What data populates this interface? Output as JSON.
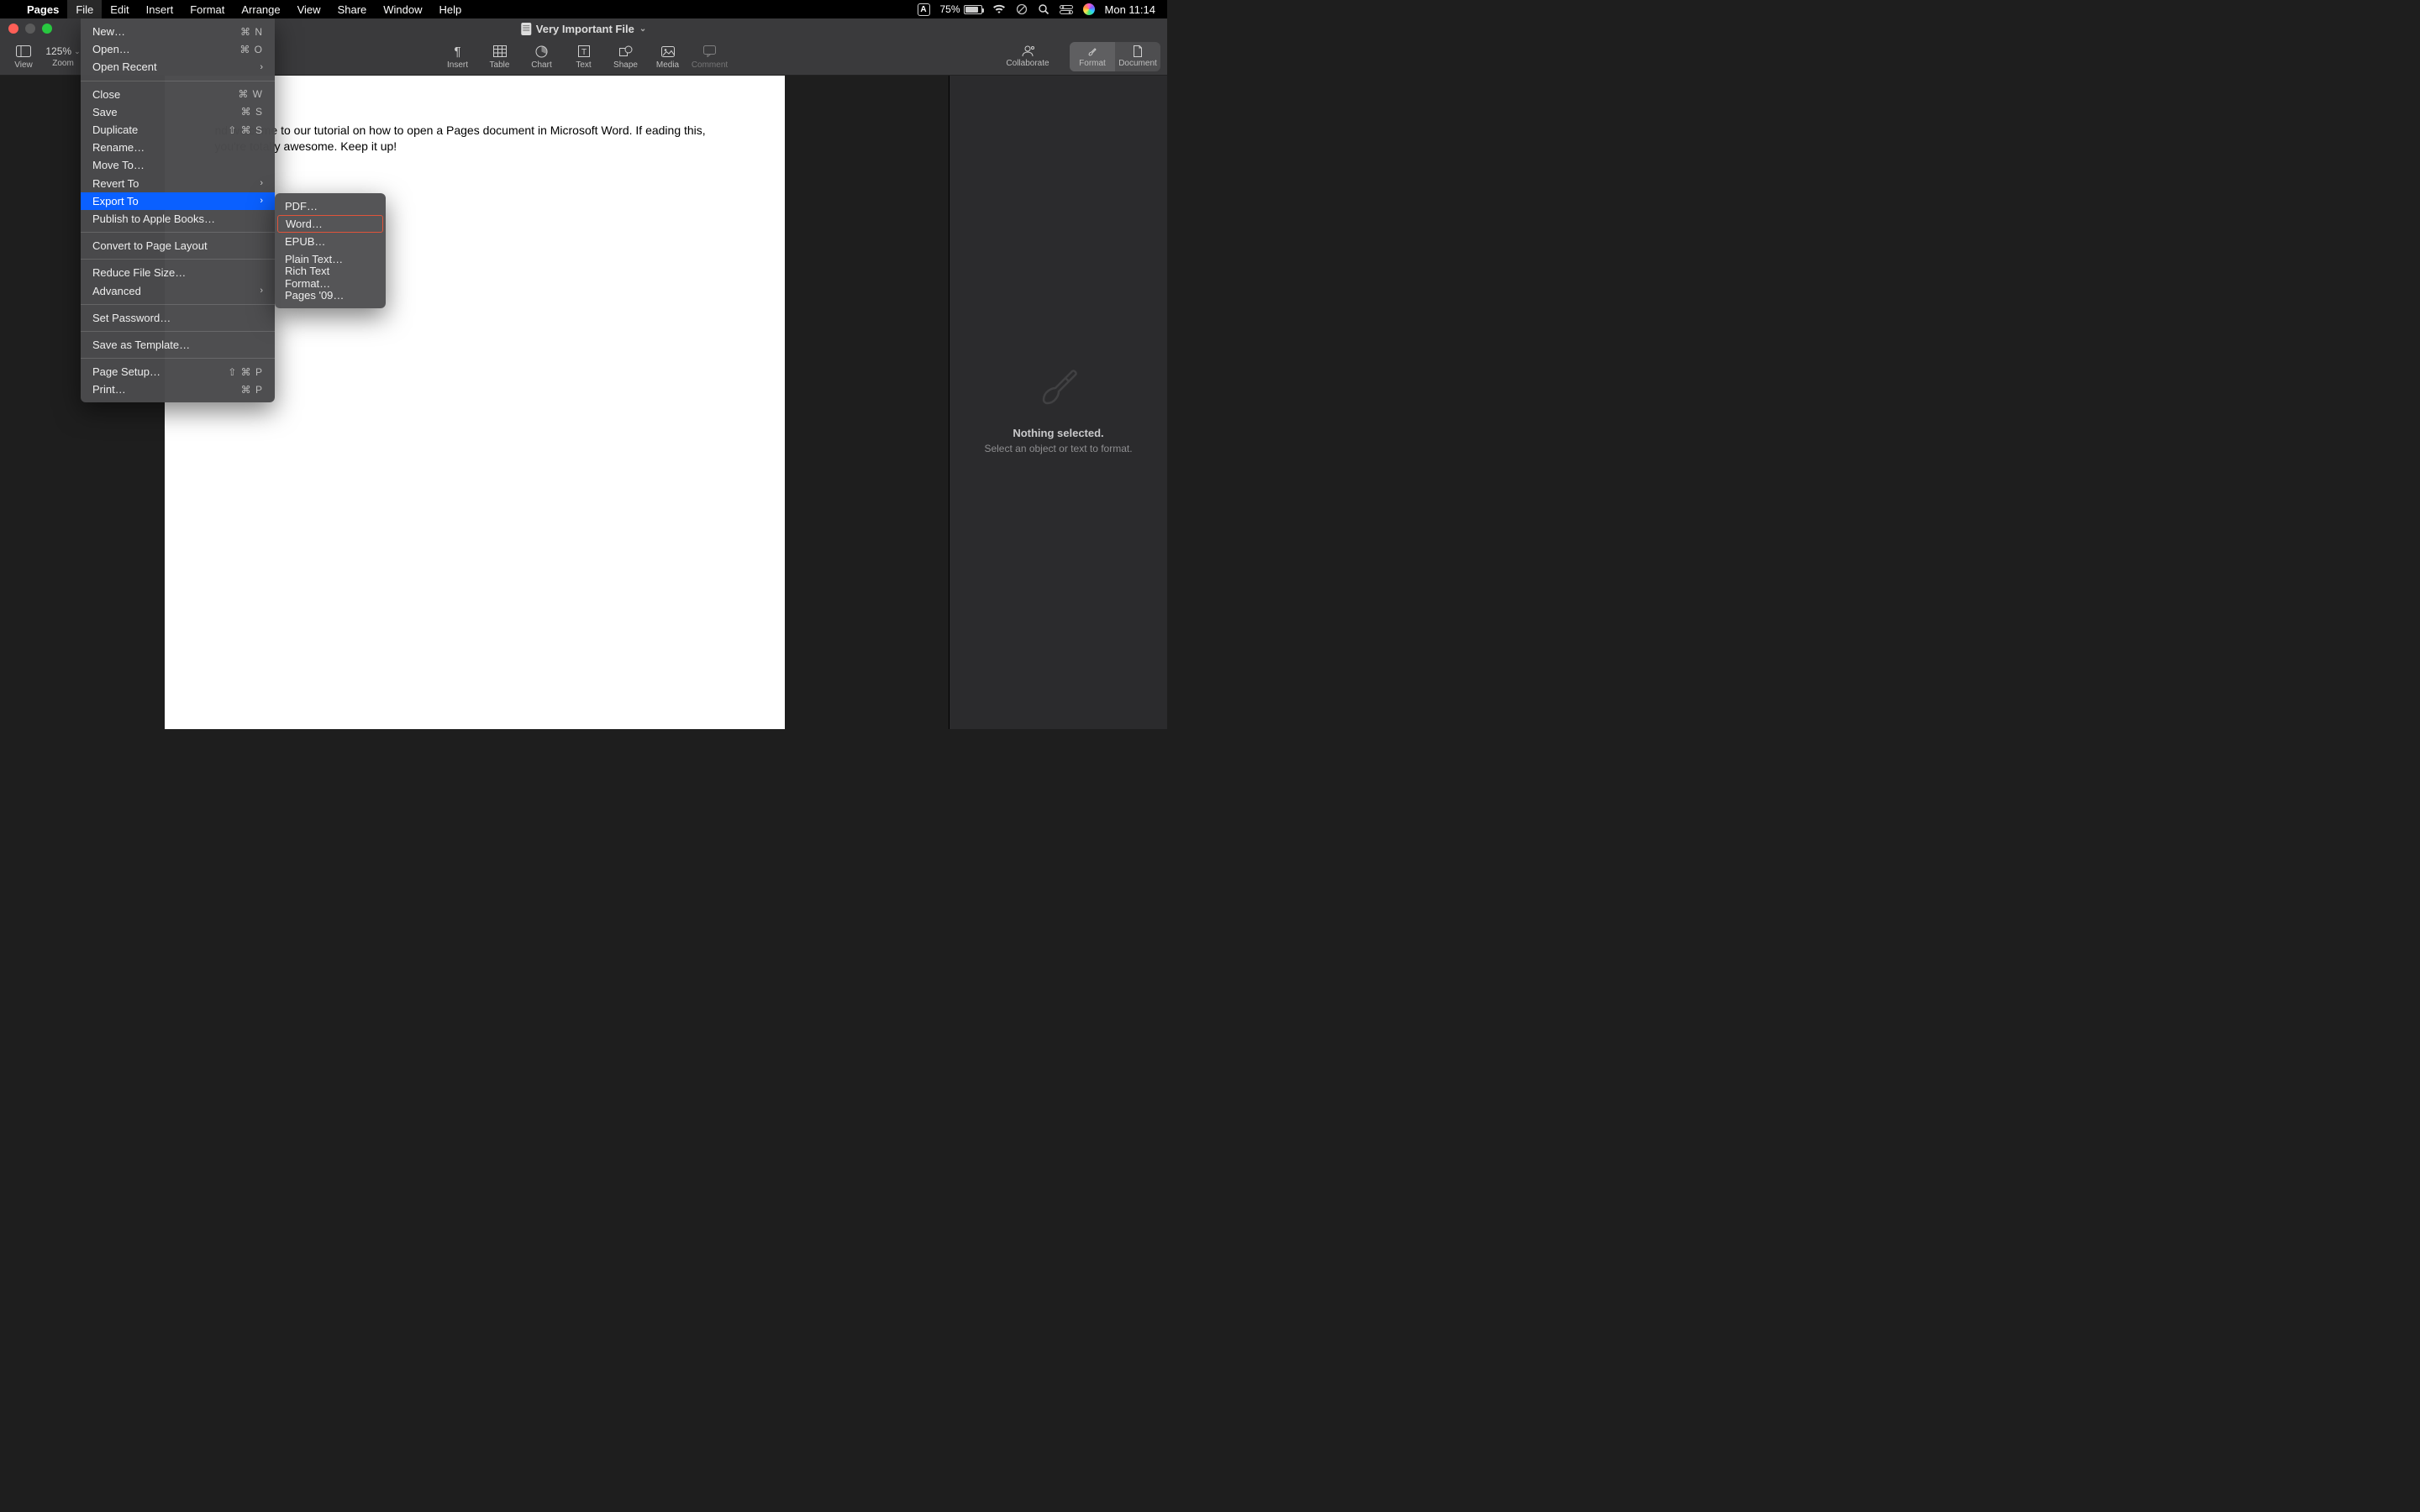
{
  "menubar": {
    "app_name": "Pages",
    "items": [
      "File",
      "Edit",
      "Insert",
      "Format",
      "Arrange",
      "View",
      "Share",
      "Window",
      "Help"
    ],
    "battery_pct": "75%",
    "input_indicator": "A",
    "clock": "Mon 11:14"
  },
  "window": {
    "doc_title": "Very Important File"
  },
  "toolbar": {
    "view": "View",
    "zoom_value": "125%",
    "zoom_label": "Zoom",
    "insert": "Insert",
    "table": "Table",
    "chart": "Chart",
    "text": "Text",
    "shape": "Shape",
    "media": "Media",
    "comment": "Comment",
    "collaborate": "Collaborate",
    "format": "Format",
    "document": "Document"
  },
  "file_menu": {
    "new": "New…",
    "new_sc": "⌘ N",
    "open": "Open…",
    "open_sc": "⌘ O",
    "open_recent": "Open Recent",
    "close": "Close",
    "close_sc": "⌘ W",
    "save": "Save",
    "save_sc": "⌘ S",
    "duplicate": "Duplicate",
    "duplicate_sc": "⇧ ⌘ S",
    "rename": "Rename…",
    "move_to": "Move To…",
    "revert_to": "Revert To",
    "export_to": "Export To",
    "publish": "Publish to Apple Books…",
    "convert": "Convert to Page Layout",
    "reduce": "Reduce File Size…",
    "advanced": "Advanced",
    "set_password": "Set Password…",
    "save_template": "Save as Template…",
    "page_setup": "Page Setup…",
    "page_setup_sc": "⇧ ⌘ P",
    "print": "Print…",
    "print_sc": "⌘ P"
  },
  "export_submenu": {
    "pdf": "PDF…",
    "word": "Word…",
    "epub": "EPUB…",
    "plain": "Plain Text…",
    "rtf": "Rich Text Format…",
    "pages09": "Pages '09…"
  },
  "document_text": "nd welcome to our tutorial on how to open a Pages document in Microsoft Word. If eading this, you're totally awesome. Keep it up!",
  "inspector": {
    "title": "Nothing selected.",
    "subtitle": "Select an object or text to format."
  }
}
